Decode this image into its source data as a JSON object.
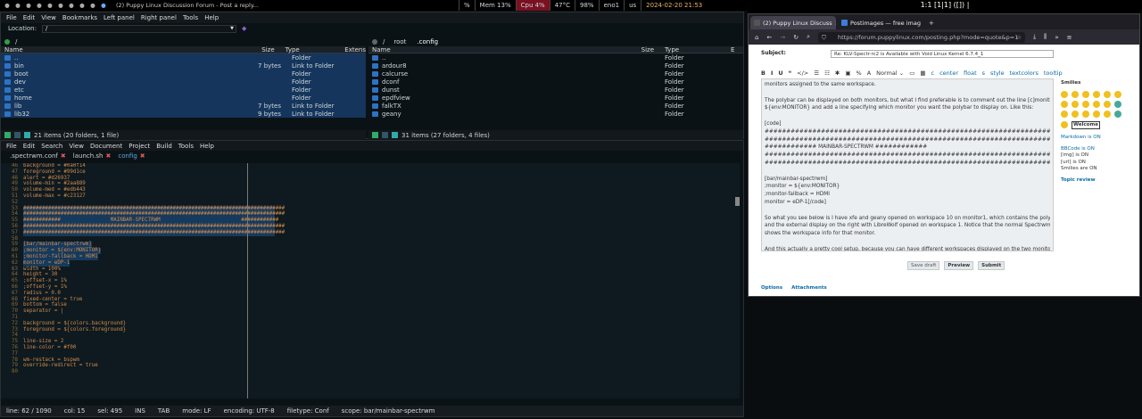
{
  "topbar": {
    "workspaces": [
      "1",
      "2",
      "3",
      "4",
      "5",
      "6",
      "7",
      "8",
      "9",
      "10"
    ],
    "window_title": "(2) Puppy Linux Discussion Forum - Post a reply...",
    "modules": [
      "%",
      "Mem 13%",
      "Cpu 4%",
      "47°C",
      "98%",
      "eno1",
      "us",
      "2024-02-20 21:53"
    ],
    "layout": "1:1 [1|1] ([]) |"
  },
  "fm": {
    "menu": [
      "File",
      "Edit",
      "View",
      "Bookmarks",
      "Left panel",
      "Right panel",
      "Tools",
      "Help"
    ],
    "location_label": "Location:",
    "location_value": "/",
    "left": {
      "path": [
        "/"
      ],
      "headers": {
        "name": "Name",
        "size": "Size",
        "type": "Type",
        "ext": "Extens"
      },
      "rows": [
        {
          "name": "..",
          "size": "",
          "type": "Folder",
          "sel": true
        },
        {
          "name": "bin",
          "size": "7 bytes",
          "type": "Link to Folder",
          "sel": true
        },
        {
          "name": "boot",
          "size": "",
          "type": "Folder",
          "sel": true
        },
        {
          "name": "dev",
          "size": "",
          "type": "Folder",
          "sel": true
        },
        {
          "name": "etc",
          "size": "",
          "type": "Folder",
          "sel": true
        },
        {
          "name": "home",
          "size": "",
          "type": "Folder",
          "sel": true
        },
        {
          "name": "lib",
          "size": "7 bytes",
          "type": "Link to Folder",
          "sel": true
        },
        {
          "name": "lib32",
          "size": "9 bytes",
          "type": "Link to Folder",
          "sel": true
        }
      ],
      "status": "21 items (20 folders, 1 file)"
    },
    "right": {
      "path": [
        "/",
        "root",
        ".config"
      ],
      "headers": {
        "name": "Name",
        "size": "Size",
        "type": "Type",
        "ext": "E"
      },
      "rows": [
        {
          "name": "..",
          "size": "",
          "type": "Folder"
        },
        {
          "name": "ardour8",
          "size": "",
          "type": "Folder"
        },
        {
          "name": "calcurse",
          "size": "",
          "type": "Folder"
        },
        {
          "name": "dconf",
          "size": "",
          "type": "Folder"
        },
        {
          "name": "dunst",
          "size": "",
          "type": "Folder"
        },
        {
          "name": "epdfview",
          "size": "",
          "type": "Folder"
        },
        {
          "name": "falkTX",
          "size": "",
          "type": "Folder"
        },
        {
          "name": "geany",
          "size": "",
          "type": "Folder"
        }
      ],
      "status": "31 items (27 folders, 4 files)"
    }
  },
  "geany": {
    "menu": [
      "File",
      "Edit",
      "Search",
      "View",
      "Document",
      "Project",
      "Build",
      "Tools",
      "Help"
    ],
    "tabs": [
      {
        "label": ".spectrwm.conf",
        "active": false
      },
      {
        "label": "launch.sh",
        "active": false
      },
      {
        "label": "config",
        "active": true
      }
    ],
    "lines": [
      {
        "n": "46",
        "t": "background = #0a0f14"
      },
      {
        "n": "47",
        "t": "foreground = #99d1ce"
      },
      {
        "n": "48",
        "t": "alert = #d26937"
      },
      {
        "n": "49",
        "t": "volume-min = #2aa889"
      },
      {
        "n": "50",
        "t": "volume-med = #edb443"
      },
      {
        "n": "51",
        "t": "volume-max = #c23127"
      },
      {
        "n": "52",
        "t": ""
      },
      {
        "n": "53",
        "t": "####################################################################################"
      },
      {
        "n": "54",
        "t": "####################################################################################"
      },
      {
        "n": "55",
        "t": "############                MAINBAR-SPECTRWM                          ############"
      },
      {
        "n": "56",
        "t": "####################################################################################"
      },
      {
        "n": "57",
        "t": "####################################################################################"
      },
      {
        "n": "58",
        "t": ""
      },
      {
        "n": "59",
        "t": "[bar/mainbar-spectrwm]"
      },
      {
        "n": "60",
        "t": ";monitor = ${env:MONITOR}"
      },
      {
        "n": "61",
        "t": ";monitor-fallback = HDMI"
      },
      {
        "n": "62",
        "t": "monitor = eDP-1"
      },
      {
        "n": "63",
        "t": "width = 100%"
      },
      {
        "n": "64",
        "t": "height = 30"
      },
      {
        "n": "65",
        "t": ";offset-x = 1%"
      },
      {
        "n": "66",
        "t": ";offset-y = 1%"
      },
      {
        "n": "67",
        "t": "radius = 0.0"
      },
      {
        "n": "68",
        "t": "fixed-center = true"
      },
      {
        "n": "69",
        "t": "bottom = false"
      },
      {
        "n": "70",
        "t": "separator = |"
      },
      {
        "n": "71",
        "t": ""
      },
      {
        "n": "72",
        "t": "background = ${colors.background}"
      },
      {
        "n": "73",
        "t": "foreground = ${colors.foreground}"
      },
      {
        "n": "74",
        "t": ""
      },
      {
        "n": "75",
        "t": "line-size = 2"
      },
      {
        "n": "76",
        "t": "line-color = #f00"
      },
      {
        "n": "77",
        "t": ""
      },
      {
        "n": "78",
        "t": "wm-restack = bspwm"
      },
      {
        "n": "79",
        "t": "override-redirect = true"
      },
      {
        "n": "80",
        "t": ""
      }
    ],
    "status": [
      "line: 62 / 1090",
      "col: 15",
      "sel: 495",
      "INS",
      "TAB",
      "mode: LF",
      "encoding: UTF-8",
      "filetype: Conf",
      "scope: bar/mainbar-spectrwm"
    ]
  },
  "browser": {
    "tabs": [
      {
        "label": "(2) Puppy Linux Discuss",
        "active": true
      },
      {
        "label": "Postimages — free imag",
        "active": false
      }
    ],
    "new_tab": "+",
    "url": "https://forum.puppylinux.com/posting.php?mode=quote&p=1",
    "subject_label": "Subject:",
    "subject_value": "Re: KLV-Spectr-rc2 is Available with Void Linux Kernel 6.7.4_1",
    "toolbar": [
      "B",
      "I",
      "U",
      "❝",
      "</>",
      "☰",
      "☷",
      "✱",
      "▣",
      "%",
      "A",
      "Normal ⌄",
      "▭",
      "▦",
      "c",
      "center",
      "float",
      "s",
      "style",
      "textcolors",
      "tooltip"
    ],
    "body": [
      "monitors assigned to the same workspace.",
      "",
      "The polybar can be displayed on both monitors, but what I find preferable is to comment out the line [c]monitor =",
      "${env:MONITOR} and add a line specifying which monitor you want the polybar to display on. Like this:",
      "",
      "[code]",
      "####################################################################################",
      "####################################################################################",
      "############                MAINBAR-SPECTRWM                          ############",
      "####################################################################################",
      "####################################################################################",
      "",
      "[bar/mainbar-spectrwm]",
      ";monitor = ${env:MONITOR}",
      ";monitor-fallback = HDMI",
      "monitor = eDP-1[/code]",
      "",
      "So what you see below is I have xfe and geany opened on workspace 10 on monitor1, which contains the polybar,",
      "and the external display on the right with LibreWolf opened on workspace 1. Notice that the normal Spectrwm bar",
      "shows the workspace info for that monitor.",
      "",
      "And this actually a pretty cool setup, because you can have different workspaces displayed on the two monitors."
    ],
    "side": {
      "smilies": "Smilies",
      "welcome": "Welcome",
      "markdown": "Markdown is ON",
      "bbcode": "BBCode is ON",
      "img": "[img] is ON",
      "url": "[url] is ON",
      "smilies_on": "Smilies are ON",
      "topic": "Topic review"
    },
    "buttons": [
      "Save draft",
      "Preview",
      "Submit"
    ],
    "option_tabs": [
      "Options",
      "Attachments"
    ]
  }
}
